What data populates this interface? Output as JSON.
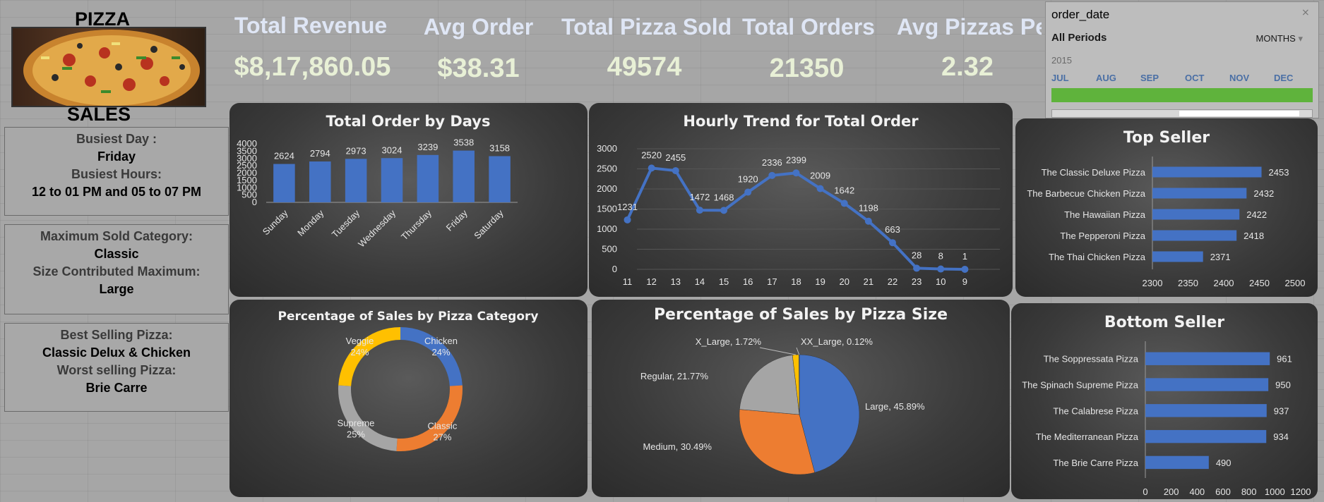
{
  "brand": {
    "top": "PIZZA",
    "bottom": "SALES"
  },
  "kpis": [
    {
      "title": "Total Revenue",
      "value": "$8,17,860.05"
    },
    {
      "title": "Avg Order",
      "value": "$38.31"
    },
    {
      "title": "Total Pizza Sold",
      "value": "49574"
    },
    {
      "title": "Total Orders",
      "value": "21350"
    },
    {
      "title": "Avg Pizzas Per",
      "value": "2.32"
    }
  ],
  "info": {
    "busiest_day_label": "Busiest Day :",
    "busiest_day": "Friday",
    "busiest_hours_label": "Busiest Hours:",
    "busiest_hours": "12 to 01 PM and 05 to 07 PM",
    "max_category_label": "Maximum Sold Category:",
    "max_category": "Classic",
    "size_label": "Size Contributed Maximum:",
    "size": "Large",
    "best_label": "Best Selling Pizza:",
    "best": "Classic Delux & Chicken",
    "worst_label": "Worst selling Pizza:",
    "worst": "Brie Carre"
  },
  "slicer": {
    "field": "order_date",
    "period": "All Periods",
    "level": "MONTHS",
    "year": "2015",
    "months": [
      "JUL",
      "AUG",
      "SEP",
      "OCT",
      "NOV",
      "DEC"
    ]
  },
  "colors": {
    "blue": "#4472c4",
    "orange": "#ed7d31",
    "gray": "#a5a5a5",
    "yellow": "#ffc000",
    "panel": "#3a3a3a"
  },
  "chart_data": [
    {
      "type": "bar",
      "title": "Total Order by Days",
      "categories": [
        "Sunday",
        "Monday",
        "Tuesday",
        "Wednesday",
        "Thursday",
        "Friday",
        "Saturday"
      ],
      "values": [
        2624,
        2794,
        2973,
        3024,
        3239,
        3538,
        3158
      ],
      "ylim": [
        0,
        4000
      ],
      "yticks": [
        0,
        500,
        1000,
        1500,
        2000,
        2500,
        3000,
        3500,
        4000
      ]
    },
    {
      "type": "line",
      "title": "Hourly Trend for Total Order",
      "categories": [
        "11",
        "12",
        "13",
        "14",
        "15",
        "16",
        "17",
        "18",
        "19",
        "20",
        "21",
        "22",
        "23",
        "10",
        "9"
      ],
      "values": [
        1231,
        2520,
        2455,
        1472,
        1468,
        1920,
        2336,
        2399,
        2009,
        1642,
        1198,
        663,
        28,
        8,
        1
      ],
      "ylim": [
        0,
        3000
      ],
      "yticks": [
        0,
        500,
        1000,
        1500,
        2000,
        2500,
        3000
      ]
    },
    {
      "type": "bar",
      "orientation": "horizontal",
      "title": "Top Seller",
      "categories": [
        "The Classic Deluxe Pizza",
        "The Barbecue Chicken Pizza",
        "The Hawaiian Pizza",
        "The Pepperoni Pizza",
        "The Thai Chicken Pizza"
      ],
      "values": [
        2453,
        2432,
        2422,
        2418,
        2371
      ],
      "xlim": [
        2300,
        2500
      ],
      "xticks": [
        2300,
        2350,
        2400,
        2450,
        2500
      ]
    },
    {
      "type": "pie",
      "variant": "donut",
      "title": "Percentage of Sales by Pizza Category",
      "labels": [
        "Chicken",
        "Classic",
        "Supreme",
        "Veggie"
      ],
      "values": [
        24,
        27,
        25,
        24
      ],
      "value_labels": [
        "24%",
        "27%",
        "25%",
        "24%"
      ]
    },
    {
      "type": "pie",
      "title": "Percentage of Sales by Pizza Size",
      "labels": [
        "Large",
        "Medium",
        "Regular",
        "X_Large",
        "XX_Large"
      ],
      "values": [
        45.89,
        30.49,
        21.77,
        1.72,
        0.12
      ],
      "value_labels": [
        "Large, 45.89%",
        "Medium, 30.49%",
        "Regular, 21.77%",
        "X_Large, 1.72%",
        "XX_Large, 0.12%"
      ]
    },
    {
      "type": "bar",
      "orientation": "horizontal",
      "title": "Bottom Seller",
      "categories": [
        "The Soppressata Pizza",
        "The Spinach Supreme Pizza",
        "The Calabrese Pizza",
        "The Mediterranean Pizza",
        "The Brie Carre Pizza"
      ],
      "values": [
        961,
        950,
        937,
        934,
        490
      ],
      "xlim": [
        0,
        1200
      ],
      "xticks": [
        0,
        200,
        400,
        600,
        800,
        1000,
        1200
      ]
    }
  ]
}
